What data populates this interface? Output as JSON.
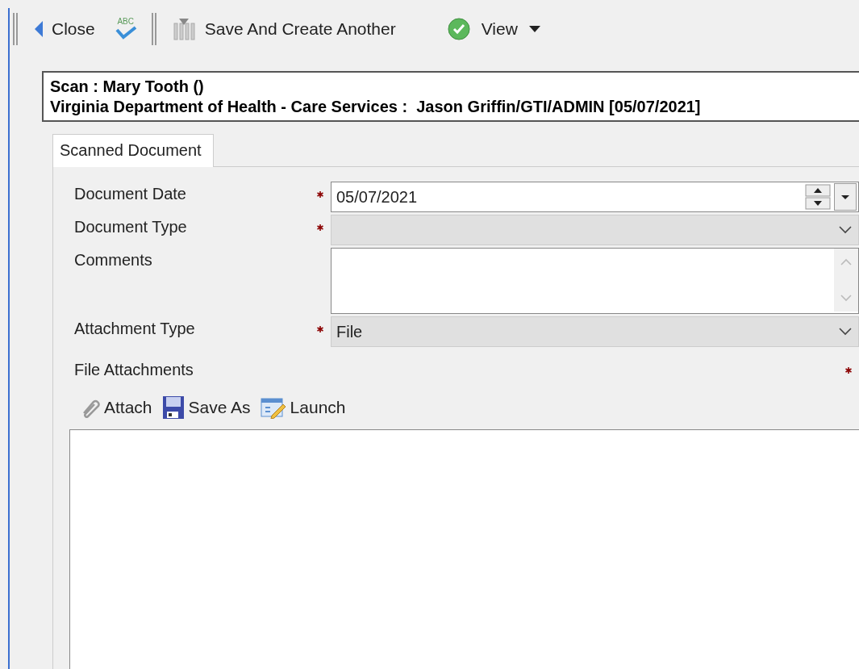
{
  "toolbar": [
    {
      "kind": "back",
      "label": "Close"
    },
    {
      "kind": "spell",
      "label": "ABC"
    },
    {
      "kind": "separator"
    },
    {
      "kind": "save",
      "label": "Save And Create Another"
    },
    {
      "kind": "view",
      "label": "View"
    }
  ],
  "header": {
    "line_1": "Scan : Mary Tooth ()",
    "line_2": "Virginia Department of Health - Care Services :  Jason Griffin/GTI/ADMIN [05/07/2021]"
  },
  "tabs": [
    {
      "label": "Scanned Document",
      "selected": true
    }
  ],
  "fields": [
    {
      "kind": "date",
      "label": "Document Date",
      "required": true,
      "value": "05/07/2021"
    },
    {
      "kind": "dropdown",
      "label": "Document Type",
      "required": true
    },
    {
      "kind": "textarea",
      "label": "Comments",
      "required": false
    },
    {
      "kind": "dropdown",
      "label": "Attachment Type",
      "required": true,
      "value": "File"
    },
    {
      "kind": "heading",
      "label": "File Attachments",
      "required": true
    }
  ],
  "attachment_actions": [
    {
      "kind": "attach",
      "label": "Attach"
    },
    {
      "kind": "save",
      "label": "Save As"
    },
    {
      "kind": "launch",
      "label": "Launch"
    }
  ]
}
